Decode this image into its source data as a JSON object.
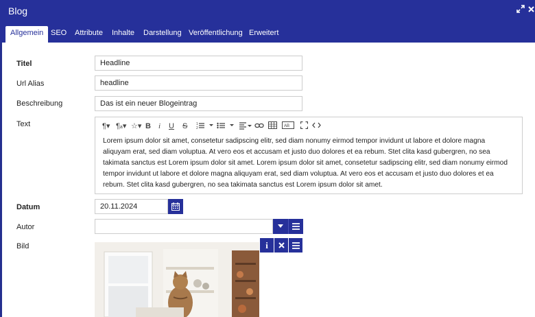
{
  "window": {
    "title": "Blog",
    "expand_icon": "expand-icon",
    "close_icon": "close-icon"
  },
  "tabs": [
    {
      "label": "Allgemein",
      "active": true
    },
    {
      "label": "SEO"
    },
    {
      "label": "Attribute"
    },
    {
      "label": "Inhalte"
    },
    {
      "label": "Darstellung"
    },
    {
      "label": "Veröffentlichung"
    },
    {
      "label": "Erweitert"
    }
  ],
  "form": {
    "titel_label": "Titel",
    "titel_value": "Headline",
    "alias_label": "Url Alias",
    "alias_value": "headline",
    "beschreibung_label": "Beschreibung",
    "beschreibung_value": "Das ist ein neuer Blogeintrag",
    "text_label": "Text",
    "datum_label": "Datum",
    "datum_value": "20.11.2024",
    "autor_label": "Autor",
    "autor_value": "",
    "bild_label": "Bild"
  },
  "editor": {
    "toolbar_icons": [
      "paragraph-format-icon",
      "paragraph-style-icon",
      "inline-style-icon",
      "bold-icon",
      "italic-icon",
      "underline-icon",
      "strikethrough-icon",
      "ordered-list-icon",
      "unordered-list-icon",
      "align-icon",
      "link-icon",
      "table-icon",
      "special-char-icon",
      "fullscreen-icon",
      "code-view-icon"
    ],
    "content": "Lorem ipsum dolor sit amet, consetetur sadipscing elitr, sed diam nonumy eirmod tempor invidunt ut labore et dolore magna aliquyam erat, sed diam voluptua. At vero eos et accusam et justo duo dolores et ea rebum. Stet clita kasd gubergren, no sea takimata sanctus est Lorem ipsum dolor sit amet. Lorem ipsum dolor sit amet, consetetur sadipscing elitr, sed diam nonumy eirmod tempor invidunt ut labore et dolore magna aliquyam erat, sed diam voluptua. At vero eos et accusam et justo duo dolores et ea rebum. Stet clita kasd gubergren, no sea takimata sanctus est Lorem ipsum dolor sit amet."
  },
  "colors": {
    "brand": "#26309a",
    "border": "#cccccc"
  }
}
